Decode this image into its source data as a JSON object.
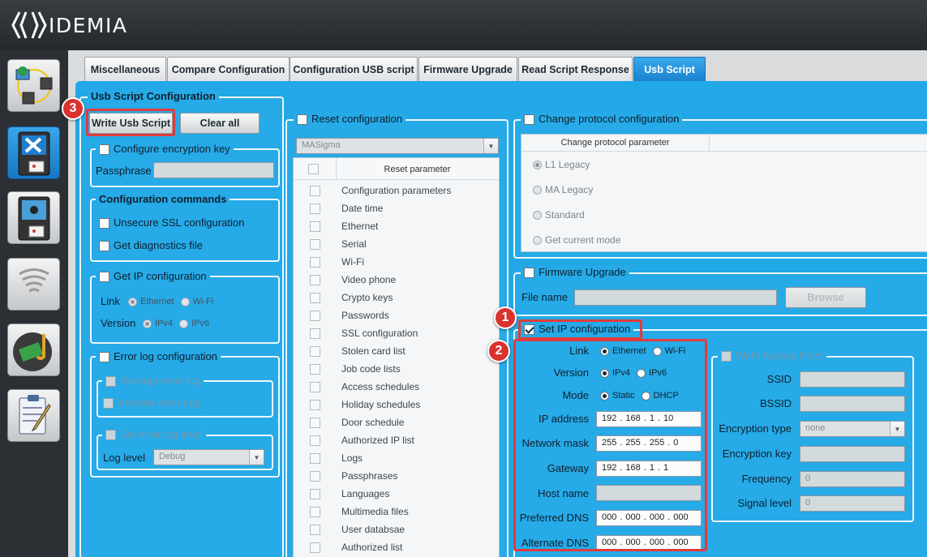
{
  "app": {
    "brand": "IDEMIA"
  },
  "tabs": [
    "Miscellaneous",
    "Compare Configuration",
    "Configuration USB script",
    "Firmware Upgrade",
    "Read Script Response",
    "Usb Script"
  ],
  "usb_script": {
    "title": "Usb Script Configuration",
    "write_button": "Write Usb Script",
    "clear_button": "Clear all",
    "encryption": {
      "label": "Configure encryption key",
      "passphrase_label": "Passphrase",
      "passphrase_value": ""
    },
    "commands": {
      "title": "Configuration commands",
      "unsecure_ssl": "Unsecure SSL configuration",
      "diagnostics": "Get diagnostics file"
    },
    "get_ip": {
      "label": "Get IP configuration",
      "link_label": "Link",
      "link_options": [
        "Ethernet",
        "Wi-Fi"
      ],
      "version_label": "Version",
      "version_options": [
        "IPv4",
        "IPv6"
      ]
    },
    "error_log": {
      "label": "Error log configuration",
      "manage": "Manage error log",
      "activate": "Activate error Log",
      "set_level": "Set error log level",
      "level_label": "Log level",
      "level_value": "Debug"
    }
  },
  "reset": {
    "label": "Reset configuration",
    "device_value": "MASigma",
    "column_header": "Reset parameter",
    "items": [
      "Configuration parameters",
      "Date time",
      "Ethernet",
      "Serial",
      "Wi-Fi",
      "Video phone",
      "Crypto keys",
      "Passwords",
      "SSL configuration",
      "Stolen card list",
      "Job code lists",
      "Access schedules",
      "Holiday schedules",
      "Door schedule",
      "Authorized IP list",
      "Logs",
      "Passphrases",
      "Languages",
      "Multimedia files",
      "User databsae",
      "Authorized list"
    ]
  },
  "protocol": {
    "label": "Change protocol configuration",
    "column_header": "Change protocol parameter",
    "options": [
      "L1 Legacy",
      "MA Legacy",
      "Standard",
      "Get current mode"
    ]
  },
  "firmware": {
    "label": "Firmware Upgrade",
    "file_label": "File name",
    "file_value": "",
    "browse": "Browse"
  },
  "set_ip": {
    "label": "Set IP configuration",
    "link_label": "Link",
    "link_options": [
      "Ethernet",
      "Wi-Fi"
    ],
    "version_label": "Version",
    "version_options": [
      "IPv4",
      "IPv6"
    ],
    "mode_label": "Mode",
    "mode_options": [
      "Static",
      "DHCP"
    ],
    "ip_label": "IP address",
    "ip": [
      "192",
      ".",
      "168",
      ".",
      "1",
      ".",
      "10"
    ],
    "mask_label": "Network mask",
    "mask": [
      "255",
      ".",
      "255",
      ".",
      "255",
      ".",
      "0"
    ],
    "gateway_label": "Gateway",
    "gateway": [
      "192",
      ".",
      "168",
      ".",
      "1",
      ".",
      "1"
    ],
    "host_label": "Host name",
    "host_value": "",
    "pdns_label": "Preferred DNS",
    "pdns": [
      "000",
      ".",
      "000",
      ".",
      "000",
      ".",
      "000"
    ],
    "adns_label": "Alternate DNS",
    "adns": [
      "000",
      ".",
      "000",
      ".",
      "000",
      ".",
      "000"
    ]
  },
  "wifi": {
    "label": "Wi-Fi Access Point",
    "ssid_label": "SSID",
    "bssid_label": "BSSID",
    "enc_type_label": "Encryption type",
    "enc_type_value": "none",
    "enc_key_label": "Encryption key",
    "freq_label": "Frequency",
    "freq_value": "0",
    "signal_label": "Signal level",
    "signal_value": "0"
  },
  "badges": [
    "1",
    "2",
    "3"
  ],
  "colors": {
    "panel": "#26aae8",
    "tab_active": "#1a82cf",
    "highlight": "#e23b3b",
    "header": "#2f3338"
  }
}
